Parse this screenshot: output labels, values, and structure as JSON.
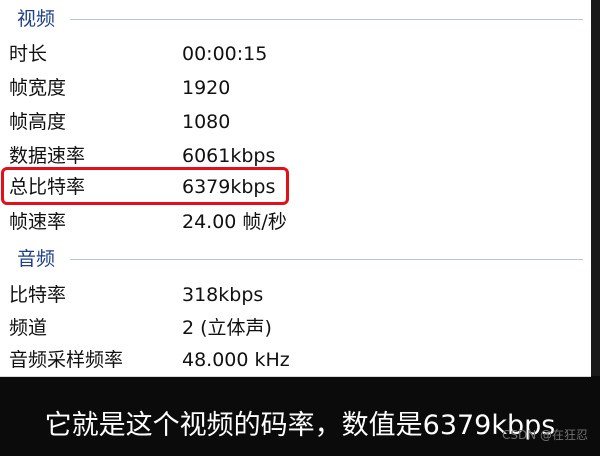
{
  "video_section": {
    "title": "视频",
    "rows": [
      {
        "label": "时长",
        "value": "00:00:15"
      },
      {
        "label": "帧宽度",
        "value": "1920"
      },
      {
        "label": "帧高度",
        "value": "1080"
      },
      {
        "label": "数据速率",
        "value": "6061kbps"
      },
      {
        "label": "总比特率",
        "value": "6379kbps"
      },
      {
        "label": "帧速率",
        "value": "24.00 帧/秒"
      }
    ]
  },
  "audio_section": {
    "title": "音频",
    "rows": [
      {
        "label": "比特率",
        "value": "318kbps"
      },
      {
        "label": "频道",
        "value": "2 (立体声)"
      },
      {
        "label": "音频采样频率",
        "value": "48.000 kHz"
      }
    ]
  },
  "subtitle": {
    "text": "它就是这个视频的码率，数值是6379kbps"
  },
  "watermark": {
    "text": "CSDN @在狂忍"
  },
  "colors": {
    "section_title": "#1e3f8a",
    "highlight": "#e3101c"
  }
}
